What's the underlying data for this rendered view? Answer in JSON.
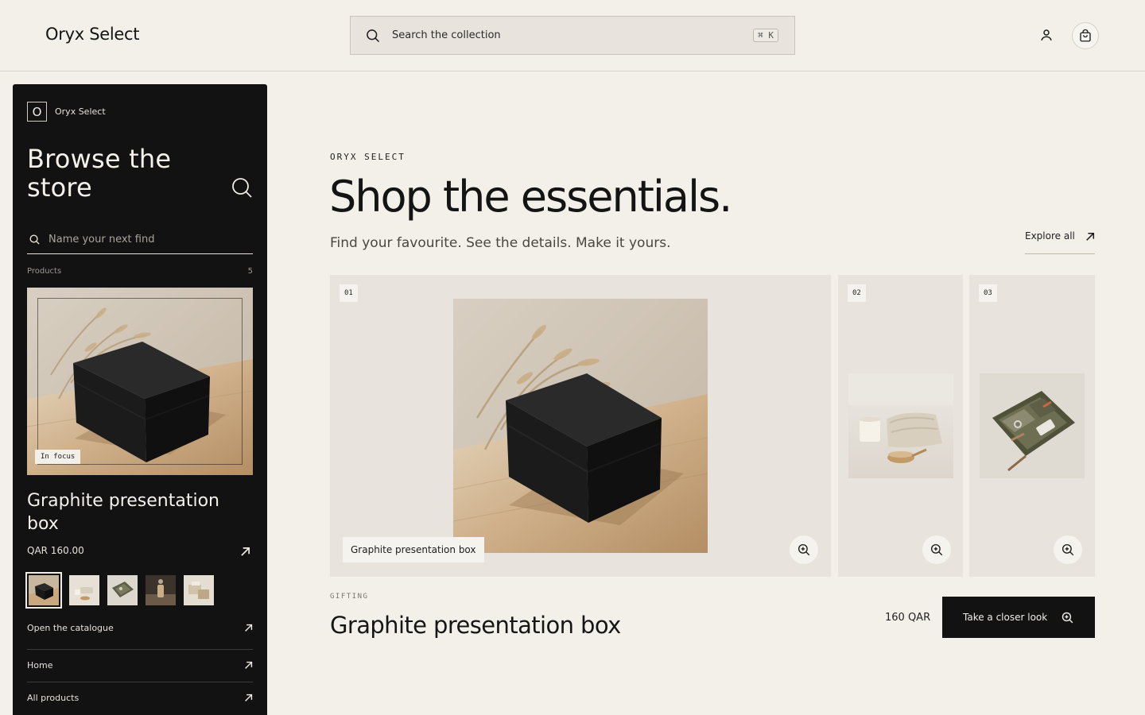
{
  "header": {
    "brand": "Oryx Select",
    "search_placeholder": "Search the collection",
    "search_shortcut": "⌘ K"
  },
  "sidebar": {
    "logo_mark": "O",
    "logo_name": "Oryx Select",
    "title": "Browse the store",
    "search_placeholder": "Name your next find",
    "products_label": "Products",
    "products_count": "5",
    "focus_badge": "In focus",
    "product_name": "Graphite presentation box",
    "product_price": "QAR 160.00",
    "links": [
      {
        "label": "Open the catalogue"
      },
      {
        "label": "Home"
      },
      {
        "label": "All products"
      }
    ]
  },
  "main": {
    "eyebrow": "ORYX SELECT",
    "headline": "Shop the essentials.",
    "subline": "Find your favourite. See the details. Make it yours.",
    "explore_label": "Explore all",
    "cards": [
      {
        "num": "01",
        "caption": "Graphite presentation box"
      },
      {
        "num": "02"
      },
      {
        "num": "03"
      }
    ],
    "category": "GIFTING",
    "selected_title": "Graphite presentation box",
    "selected_price": "160 QAR",
    "closer_label": "Take a closer look"
  },
  "colors": {
    "background": "#f3f0ea",
    "sidebar": "#121212",
    "card": "#e8e4dd",
    "accent_dark": "#121212"
  }
}
